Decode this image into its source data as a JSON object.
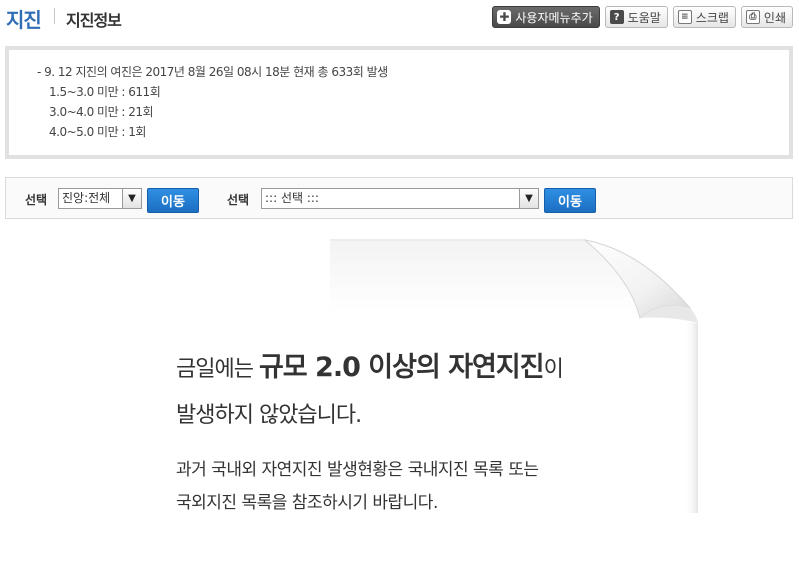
{
  "header": {
    "title": "지진",
    "subtitle": "지진정보"
  },
  "toolbar": {
    "add_menu_label": "사용자메뉴추가",
    "help_label": "도움말",
    "scrap_label": "스크랩",
    "print_label": "인쇄",
    "icons": {
      "add": "plus-icon",
      "help": "question-icon",
      "scrap": "clipboard-icon",
      "print": "printer-icon"
    }
  },
  "info": {
    "line1": "- 9. 12 지진의 여진은 2017년 8월 26일 08시 18분 현재 총 633회 발생",
    "line2": "1.5~3.0 미만 : 611회",
    "line3": "3.0~4.0 미만 : 21회",
    "line4": "4.0~5.0 미만 : 1회"
  },
  "selection": {
    "label1": "선택",
    "select1_value": "진앙:전체",
    "go1_label": "이동",
    "label2": "선택",
    "select2_value": "::: 선택 :::",
    "go2_label": "이동"
  },
  "notice": {
    "line1_pre": "금일에는 ",
    "line1_big": "규모 2.0 이상의 자연지진",
    "line1_post": "이",
    "line2": "발생하지 않았습니다.",
    "line3": "과거 국내외 자연지진 발생현황은 국내지진 목록 또는",
    "line4": "국외지진 목록을 참조하시기 바랍니다."
  },
  "colors": {
    "title_blue": "#2f6db5",
    "button_blue": "#1c6fc2",
    "box_border": "#e1e1e1"
  }
}
